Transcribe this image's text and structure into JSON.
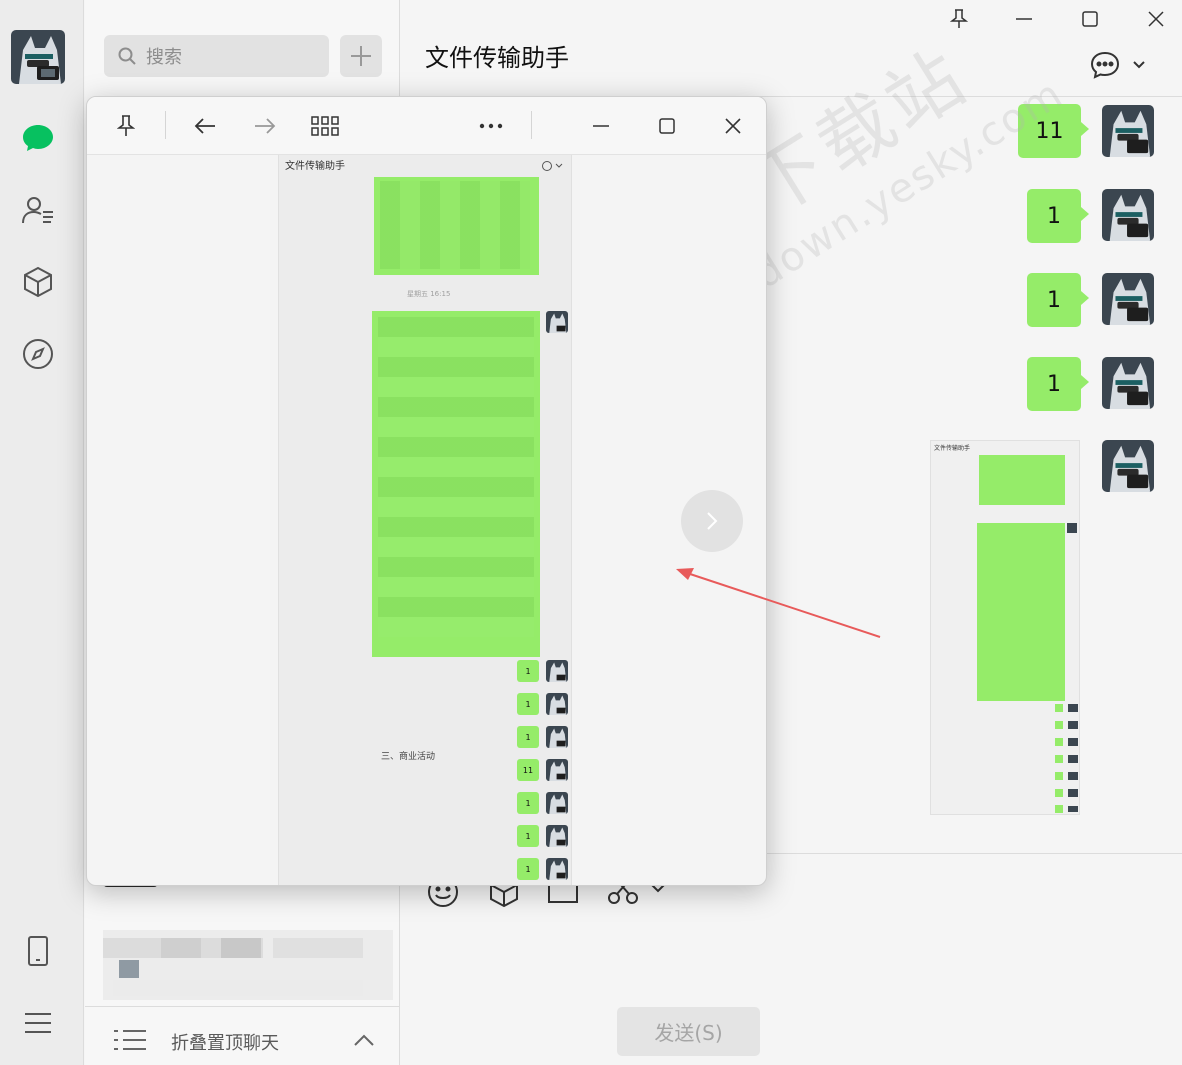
{
  "sidebar": {
    "icons": [
      "chat-icon",
      "contacts-icon",
      "box-icon",
      "discover-icon",
      "phone-icon",
      "menu-icon"
    ]
  },
  "chat_list": {
    "search_placeholder": "搜索",
    "footer_label": "折叠置顶聊天"
  },
  "chat": {
    "title": "文件传输助手",
    "messages": [
      "11",
      "1",
      "1",
      "1"
    ],
    "send_label": "发送(S)"
  },
  "watermark": {
    "text_cn": "天极下载站",
    "text_en": "mydown.yesky.com"
  },
  "viewer": {
    "screenshot": {
      "title": "文件传输助手",
      "time": "星期五 16:15",
      "bottom_text": "三、商业活动",
      "messages": [
        "1",
        "1",
        "1",
        "11",
        "1",
        "1",
        "1"
      ]
    }
  },
  "colors": {
    "bubble": "#95ec69",
    "wechat_green": "#07c160",
    "arrow": "#e85a5a"
  }
}
